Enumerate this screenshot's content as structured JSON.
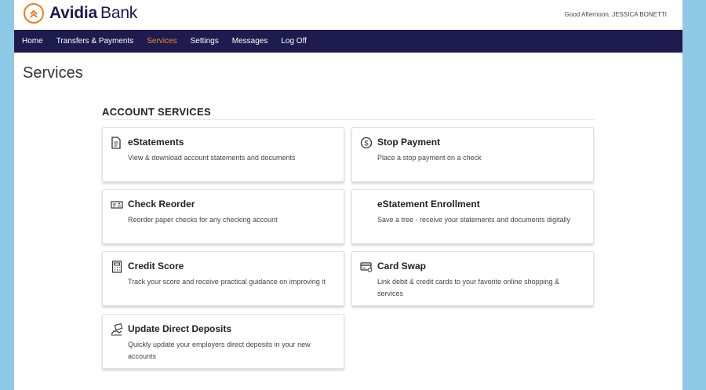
{
  "brand": {
    "name_bold": "Avidia",
    "name_rest": "Bank",
    "accent": "#f07c21",
    "navy": "#1e1b4f"
  },
  "header": {
    "greeting": "Good Afternoon, JESSICA BONETTI"
  },
  "nav": {
    "items": [
      {
        "label": "Home"
      },
      {
        "label": "Transfers & Payments"
      },
      {
        "label": "Services",
        "active": true
      },
      {
        "label": "Settings"
      },
      {
        "label": "Messages"
      },
      {
        "label": "Log Off"
      }
    ]
  },
  "page": {
    "title": "Services"
  },
  "section": {
    "title": "ACCOUNT SERVICES",
    "cards": [
      {
        "title": "eStatements",
        "desc": "View & download account statements and documents",
        "icon": "document-icon"
      },
      {
        "title": "Stop Payment",
        "desc": "Place a stop payment on a check",
        "icon": "dollar-circle-icon"
      },
      {
        "title": "Check Reorder",
        "desc": "Reorder paper checks for any checking account",
        "icon": "check-icon"
      },
      {
        "title": "eStatement Enrollment",
        "desc": "Save a tree - receive your statements and documents digitally",
        "icon": ""
      },
      {
        "title": "Credit Score",
        "desc": "Track your score and receive practical guidance on improving it",
        "icon": "calculator-icon"
      },
      {
        "title": "Card Swap",
        "desc": "Link debit & credit cards to your favorite online shopping & services",
        "icon": "card-icon"
      },
      {
        "title": "Update Direct Deposits",
        "desc": "Quickly update your employers direct deposits in your new accounts",
        "icon": "deposit-hand-icon"
      }
    ]
  }
}
